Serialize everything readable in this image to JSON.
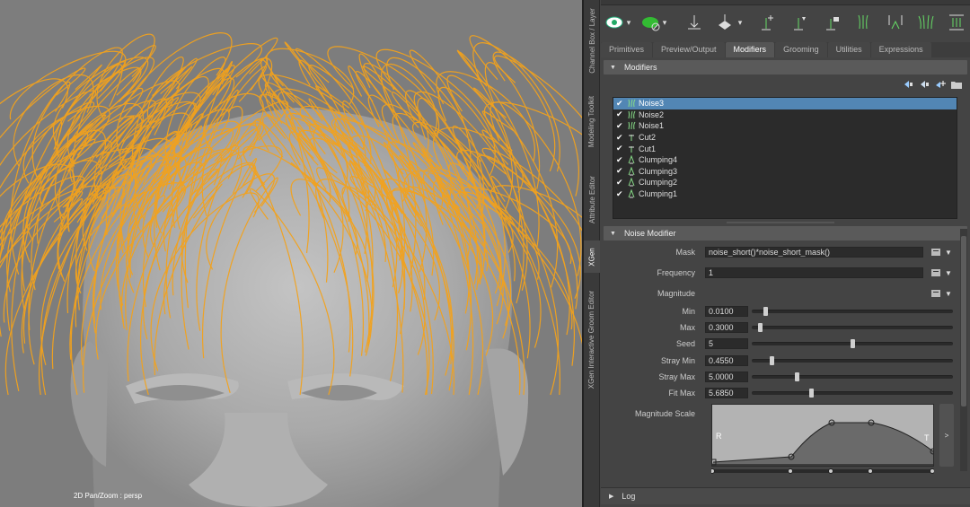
{
  "viewport": {
    "label": "2D Pan/Zoom : persp"
  },
  "vertical_tabs": [
    {
      "label": "Channel Box / Layer"
    },
    {
      "label": "Modeling Toolkit"
    },
    {
      "label": "Attribute Editor"
    },
    {
      "label": "XGen"
    },
    {
      "label": "XGen Interactive Groom Editor"
    }
  ],
  "tabs": [
    {
      "label": "Primitives"
    },
    {
      "label": "Preview/Output"
    },
    {
      "label": "Modifiers"
    },
    {
      "label": "Grooming"
    },
    {
      "label": "Utilities"
    },
    {
      "label": "Expressions"
    }
  ],
  "modifiers_section": {
    "title": "Modifiers",
    "items": [
      {
        "name": "Noise3",
        "checked": true,
        "selected": true,
        "icon": "noise-icon"
      },
      {
        "name": "Noise2",
        "checked": true,
        "selected": false,
        "icon": "noise-icon"
      },
      {
        "name": "Noise1",
        "checked": true,
        "selected": false,
        "icon": "noise-icon"
      },
      {
        "name": "Cut2",
        "checked": true,
        "selected": false,
        "icon": "cut-icon"
      },
      {
        "name": "Cut1",
        "checked": true,
        "selected": false,
        "icon": "cut-icon"
      },
      {
        "name": "Clumping4",
        "checked": true,
        "selected": false,
        "icon": "clumping-icon"
      },
      {
        "name": "Clumping3",
        "checked": true,
        "selected": false,
        "icon": "clumping-icon"
      },
      {
        "name": "Clumping2",
        "checked": true,
        "selected": false,
        "icon": "clumping-icon"
      },
      {
        "name": "Clumping1",
        "checked": true,
        "selected": false,
        "icon": "clumping-icon"
      }
    ]
  },
  "noise_modifier": {
    "title": "Noise Modifier",
    "mask_label": "Mask",
    "mask_value": "noise_short()*noise_short_mask()",
    "frequency_label": "Frequency",
    "frequency_value": "1",
    "magnitude_label": "Magnitude",
    "params": [
      {
        "label": "Min",
        "value": "0.0100",
        "slider": 0.06
      },
      {
        "label": "Max",
        "value": "0.3000",
        "slider": 0.03
      },
      {
        "label": "Seed",
        "value": "5",
        "slider": 0.5
      },
      {
        "label": "Stray Min",
        "value": "0.4550",
        "slider": 0.09
      },
      {
        "label": "Stray Max",
        "value": "5.0000",
        "slider": 0.22
      },
      {
        "label": "Fit Max",
        "value": "5.6850",
        "slider": 0.29
      }
    ],
    "magnitude_scale_label": "Magnitude Scale",
    "graph_left_letter": "R",
    "graph_right_letter": "T",
    "graph_side_glyph": ">"
  },
  "log": {
    "title": "Log"
  }
}
